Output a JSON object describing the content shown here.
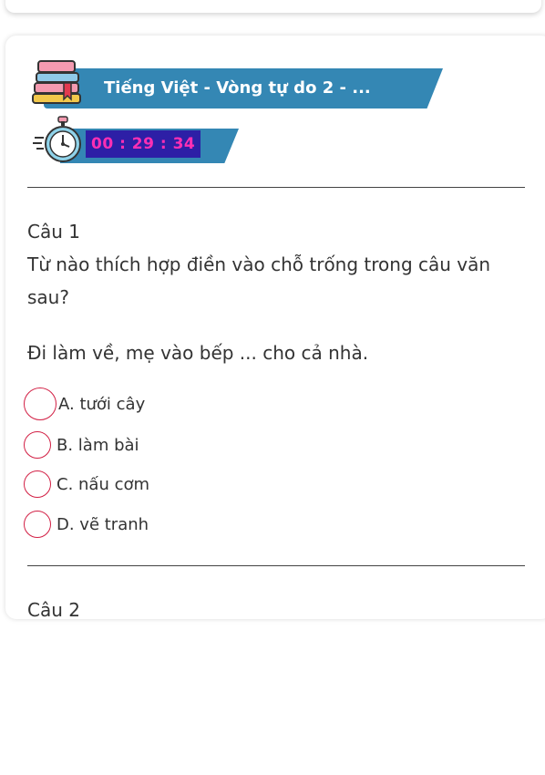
{
  "quiz": {
    "title": "Tiếng Việt - Vòng tự do 2 - ...",
    "timer": "00 : 29 : 34"
  },
  "questions": [
    {
      "number": "Câu 1",
      "prompt": "Từ nào thích hợp điền vào chỗ trống trong câu văn sau?",
      "sentence": "Đi làm về, mẹ vào bếp ... cho cả nhà.",
      "options": [
        "A. tưới cây",
        "B. làm bài",
        "C. nấu cơm",
        "D. vẽ tranh"
      ]
    },
    {
      "number": "Câu 2"
    }
  ],
  "colors": {
    "banner": "#3487b4",
    "timer_bg": "#2d1fa6",
    "timer_text": "#ff2fb4",
    "radio_border": "#d21f44"
  }
}
